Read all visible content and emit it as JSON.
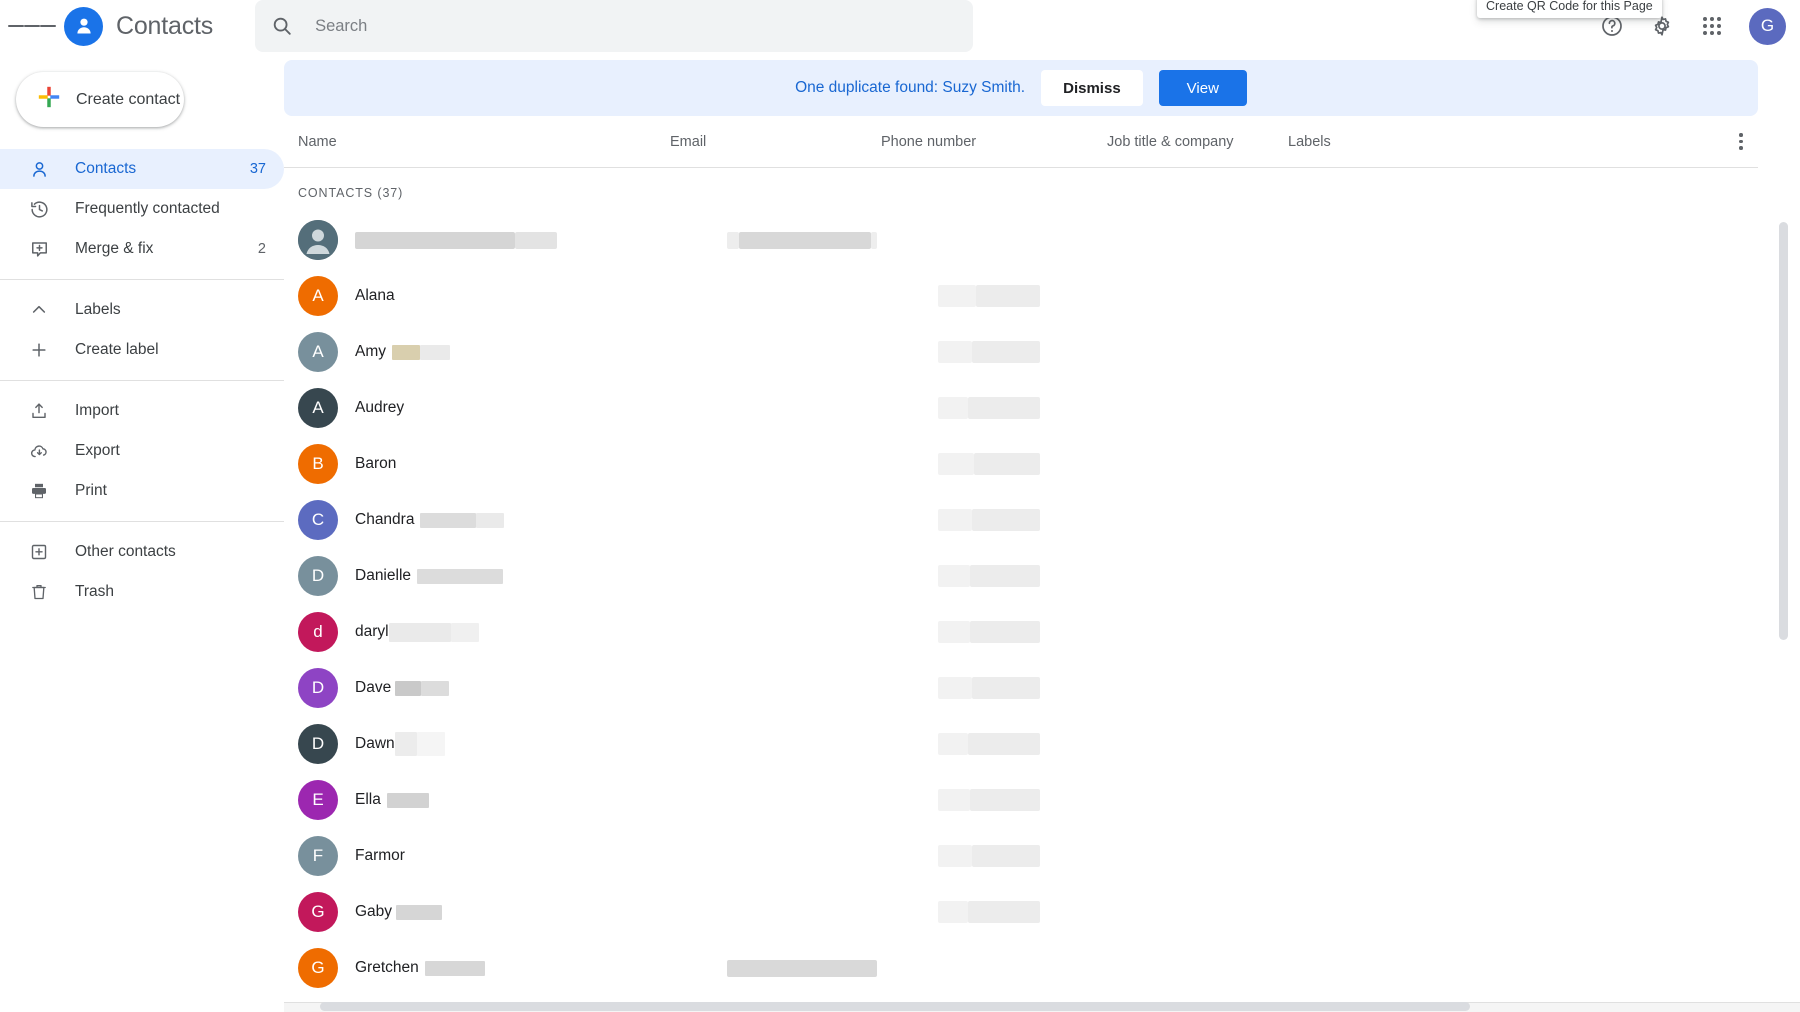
{
  "app": {
    "title": "Contacts",
    "menu_icon": "hamburger-icon",
    "logo_icon": "contacts-person-logo"
  },
  "search": {
    "placeholder": "Search",
    "value": "",
    "icon": "search-icon"
  },
  "topbar_right": {
    "tooltip": "Create QR Code for this Page",
    "help_icon": "help-circle-icon",
    "settings_icon": "gear-icon",
    "apps_icon": "apps-grid-icon",
    "avatar_letter": "G",
    "avatar_color": "#5b6abf"
  },
  "sidebar": {
    "create_contact": {
      "label": "Create contact",
      "icon": "plus-multicolor-icon"
    },
    "items": [
      {
        "label": "Contacts",
        "icon": "person-icon",
        "count": "37",
        "active": true
      },
      {
        "label": "Frequently contacted",
        "icon": "history-clock-icon",
        "count": "",
        "active": false
      },
      {
        "label": "Merge & fix",
        "icon": "merge-fix-icon",
        "count": "2",
        "active": false
      },
      {
        "label": "Labels",
        "icon": "chevron-up-icon",
        "count": "",
        "active": false
      },
      {
        "label": "Create label",
        "icon": "plus-icon",
        "count": "",
        "active": false
      },
      {
        "label": "Import",
        "icon": "import-upload-icon",
        "count": "",
        "active": false
      },
      {
        "label": "Export",
        "icon": "export-cloud-download-icon",
        "count": "",
        "active": false
      },
      {
        "label": "Print",
        "icon": "printer-icon",
        "count": "",
        "active": false
      },
      {
        "label": "Other contacts",
        "icon": "other-contacts-icon",
        "count": "",
        "active": false
      },
      {
        "label": "Trash",
        "icon": "trash-icon",
        "count": "",
        "active": false
      }
    ]
  },
  "banner": {
    "message": "One duplicate found: Suzy Smith.",
    "dismiss_label": "Dismiss",
    "view_label": "View",
    "accent_color": "#1a73e8",
    "background_color": "#e8f0fe"
  },
  "table": {
    "columns": [
      "Name",
      "Email",
      "Phone number",
      "Job title & company",
      "Labels"
    ],
    "more_icon": "more-vertical-icon",
    "section_label": "CONTACTS (37)",
    "rows": [
      {
        "name": "",
        "initial": "",
        "avatar_color": "#455a64",
        "avatar_type": "generic",
        "name_redacted": true,
        "email_redacted": true,
        "phone_redacted": false
      },
      {
        "name": "Alana",
        "initial": "A",
        "avatar_color": "#ef6c00",
        "avatar_type": "letter",
        "name_redacted": false,
        "email_redacted": false,
        "phone_redacted": true
      },
      {
        "name": "Amy",
        "initial": "A",
        "avatar_color": "#78909c",
        "avatar_type": "letter",
        "name_redacted": true,
        "email_redacted": false,
        "phone_redacted": true
      },
      {
        "name": "Audrey",
        "initial": "A",
        "avatar_color": "#37474f",
        "avatar_type": "letter",
        "name_redacted": false,
        "email_redacted": false,
        "phone_redacted": true
      },
      {
        "name": "Baron",
        "initial": "B",
        "avatar_color": "#ef6c00",
        "avatar_type": "letter",
        "name_redacted": false,
        "email_redacted": false,
        "phone_redacted": true
      },
      {
        "name": "Chandra",
        "initial": "C",
        "avatar_color": "#5c6bc0",
        "avatar_type": "letter",
        "name_redacted": true,
        "email_redacted": false,
        "phone_redacted": true
      },
      {
        "name": "Danielle",
        "initial": "D",
        "avatar_color": "#78909c",
        "avatar_type": "letter",
        "name_redacted": true,
        "email_redacted": false,
        "phone_redacted": true
      },
      {
        "name": "daryl",
        "initial": "d",
        "avatar_color": "#c2185b",
        "avatar_type": "letter",
        "name_redacted": true,
        "email_redacted": false,
        "phone_redacted": true
      },
      {
        "name": "Dave",
        "initial": "D",
        "avatar_color": "#8e44c4",
        "avatar_type": "letter",
        "name_redacted": true,
        "email_redacted": false,
        "phone_redacted": true
      },
      {
        "name": "Dawn",
        "initial": "D",
        "avatar_color": "#37474f",
        "avatar_type": "letter",
        "name_redacted": true,
        "email_redacted": false,
        "phone_redacted": true
      },
      {
        "name": "Ella",
        "initial": "E",
        "avatar_color": "#9c27b0",
        "avatar_type": "letter",
        "name_redacted": true,
        "email_redacted": false,
        "phone_redacted": true
      },
      {
        "name": "Farmor",
        "initial": "F",
        "avatar_color": "#78909c",
        "avatar_type": "letter",
        "name_redacted": false,
        "email_redacted": false,
        "phone_redacted": true
      },
      {
        "name": "Gaby",
        "initial": "G",
        "avatar_color": "#c2185b",
        "avatar_type": "letter",
        "name_redacted": true,
        "email_redacted": false,
        "phone_redacted": true
      },
      {
        "name": "Gretchen",
        "initial": "G",
        "avatar_color": "#ef6c00",
        "avatar_type": "letter",
        "name_redacted": true,
        "email_redacted": true,
        "phone_redacted": false
      }
    ]
  }
}
